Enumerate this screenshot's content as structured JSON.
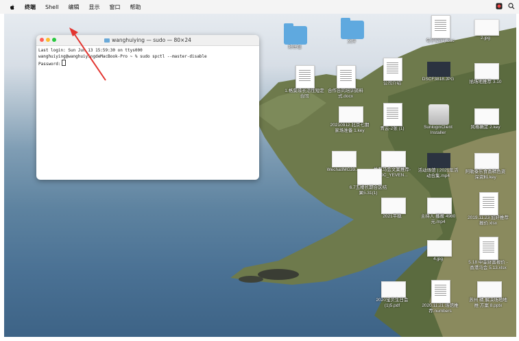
{
  "menubar": {
    "items": [
      "终端",
      "Shell",
      "编辑",
      "显示",
      "窗口",
      "帮助"
    ]
  },
  "terminal": {
    "title": "wanghuiying — sudo — 80×24",
    "lines": [
      "Last login: Sun Jun 13 15:59:30 on ttys000",
      "wanghuiying@wanghuiyingdeMacBook-Pro ~ % sudo spctl --master-disable",
      "Password:"
    ]
  },
  "desktop_icons": [
    {
      "label": "好压包",
      "type": "folder"
    },
    {
      "label": "文件",
      "type": "folder"
    },
    {
      "label": "句子(2)(1).doc",
      "type": "doc"
    },
    {
      "label": "2.jpg",
      "type": "thumb"
    },
    {
      "label": "1.格莫缘长活性短定合同",
      "type": "doc"
    },
    {
      "label": "合作合同培训资料式.docx",
      "type": "doc"
    },
    {
      "label": "公司介绍",
      "type": "doc"
    },
    {
      "label": "DSCF3818.JPG",
      "type": "dark"
    },
    {
      "label": "插场地推荐 3.10",
      "type": "thumb"
    },
    {
      "label": "20210912 北京七期家场准备 1.key",
      "type": "thumb"
    },
    {
      "label": "青云-2张 (1)",
      "type": "doc"
    },
    {
      "label": "SunloginClient Installer",
      "type": "installer"
    },
    {
      "label": "风格确定 2.key",
      "type": "thumb"
    },
    {
      "label": "WechatIMG39...",
      "type": "thumb"
    },
    {
      "label": "推荐马会文案推荐-DOC_YEVEN...",
      "type": "thumb"
    },
    {
      "label": "活动场馆 | 2021年活动合集.mp4",
      "type": "dark"
    },
    {
      "label": "阿勒泰乐食香精色资深资料.key",
      "type": "thumb"
    },
    {
      "label": "6.7五楼长期合区结果5.31(1)",
      "type": "thumb"
    },
    {
      "label": "2021平稳",
      "type": "thumb"
    },
    {
      "label": "主持人 播报 4980元.mp4",
      "type": "thumb"
    },
    {
      "label": "2019.11.23 加好推荐报价.xlsx",
      "type": "doc"
    },
    {
      "label": "4.jpg",
      "type": "thumb"
    },
    {
      "label": "5.18 中金财富报价 - 香港马会 5.13.xlsx",
      "type": "doc"
    },
    {
      "label": "2020宝贝生日会 (1)5.pdf",
      "type": "thumb"
    },
    {
      "label": "2020.11.21 场馆推荐.numbers",
      "type": "doc"
    },
    {
      "label": "苏州 精 解决场地地推 方案 8.pptx",
      "type": "thumb"
    }
  ]
}
